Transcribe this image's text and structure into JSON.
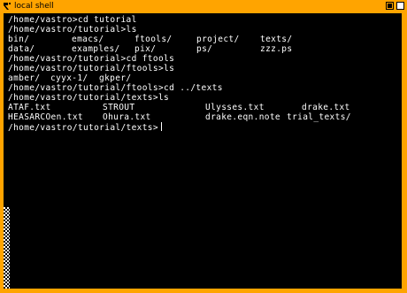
{
  "window": {
    "title": "local shell"
  },
  "terminal": {
    "lines": [
      {
        "cols": [
          "/home/vastro>cd tutorial"
        ]
      },
      {
        "cols": [
          "/home/vastro/tutorial>ls"
        ]
      },
      {
        "cols": [
          "bin/",
          "emacs/",
          "ftools/",
          "project/",
          "texts/"
        ]
      },
      {
        "cols": [
          "data/",
          "examples/",
          "pix/",
          "ps/",
          "zzz.ps"
        ]
      },
      {
        "cols": [
          "/home/vastro/tutorial>cd ftools"
        ]
      },
      {
        "cols": [
          "/home/vastro/tutorial/ftools>ls"
        ]
      },
      {
        "cols": [
          "amber/",
          "cyyx-1/",
          "gkper/"
        ]
      },
      {
        "cols": [
          "/home/vastro/tutorial/ftools>cd ../texts"
        ]
      },
      {
        "cols": [
          "/home/vastro/tutorial/texts>ls"
        ]
      },
      {
        "cols": [
          "ATAF.txt",
          "STROUT",
          "Ulysses.txt",
          "drake.txt"
        ]
      },
      {
        "cols": [
          "HEASARCOen.txt",
          "Ohura.txt",
          "drake.eqn.note",
          "trial_texts/"
        ]
      },
      {
        "cols": [
          "/home/vastro/tutorial/texts>"
        ]
      }
    ]
  }
}
